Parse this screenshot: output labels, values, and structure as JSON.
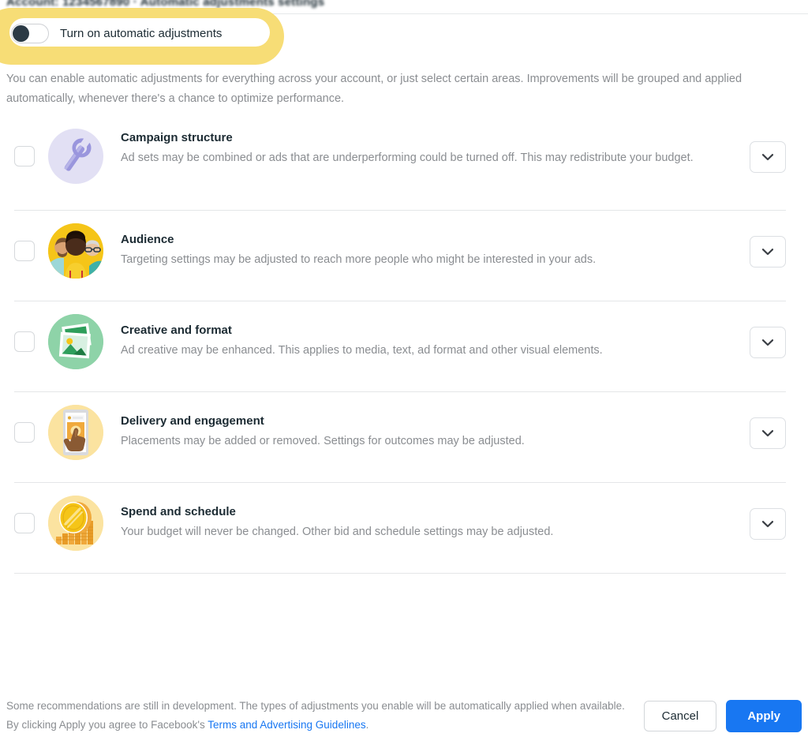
{
  "header": {
    "account_title_redacted": "Account: 1234567890 · Automatic adjustments settings"
  },
  "toggle": {
    "label": "Turn on automatic adjustments",
    "state": "off"
  },
  "annotation": {
    "type": "highlighter-oval",
    "color": "#f7dd76",
    "targets": "Turn on automatic adjustments toggle"
  },
  "intro": {
    "text": "You can enable automatic adjustments for everything across your account, or just select certain areas. Improvements will be grouped and applied automatically, whenever there's a chance to optimize performance."
  },
  "options": [
    {
      "title": "Campaign structure",
      "description": "Ad sets may be combined or ads that are underperforming could be turned off. This may redistribute your budget.",
      "icon": "wrench-icon",
      "icon_bg": "#e2e0f4",
      "checked": false,
      "expand_icon": "chevron-down-icon"
    },
    {
      "title": "Audience",
      "description": "Targeting settings may be adjusted to reach more people who might be interested in your ads.",
      "icon": "people-icon",
      "icon_bg": "#f5c518",
      "checked": false,
      "expand_icon": "chevron-down-icon"
    },
    {
      "title": "Creative and format",
      "description": "Ad creative may be enhanced. This applies to media, text, ad format and other visual elements.",
      "icon": "photos-icon",
      "icon_bg": "#8ed3a8",
      "checked": false,
      "expand_icon": "chevron-down-icon"
    },
    {
      "title": "Delivery and engagement",
      "description": "Placements may be added or removed. Settings for outcomes may be adjusted.",
      "icon": "tap-phone-icon",
      "icon_bg": "#fbe3a0",
      "checked": false,
      "expand_icon": "chevron-down-icon"
    },
    {
      "title": "Spend and schedule",
      "description": "Your budget will never be changed. Other bid and schedule settings may be adjusted.",
      "icon": "coins-icon",
      "icon_bg": "#fbe3a0",
      "checked": false,
      "expand_icon": "chevron-down-icon"
    }
  ],
  "footer": {
    "note_part1": "Some recommendations are still in development. The types of adjustments you enable will be automatically applied when available. By clicking Apply you agree to Facebook's ",
    "link_text": "Terms and Advertising Guidelines",
    "note_part2": ".",
    "cancel_label": "Cancel",
    "apply_label": "Apply",
    "apply_color": "#1877f2"
  }
}
